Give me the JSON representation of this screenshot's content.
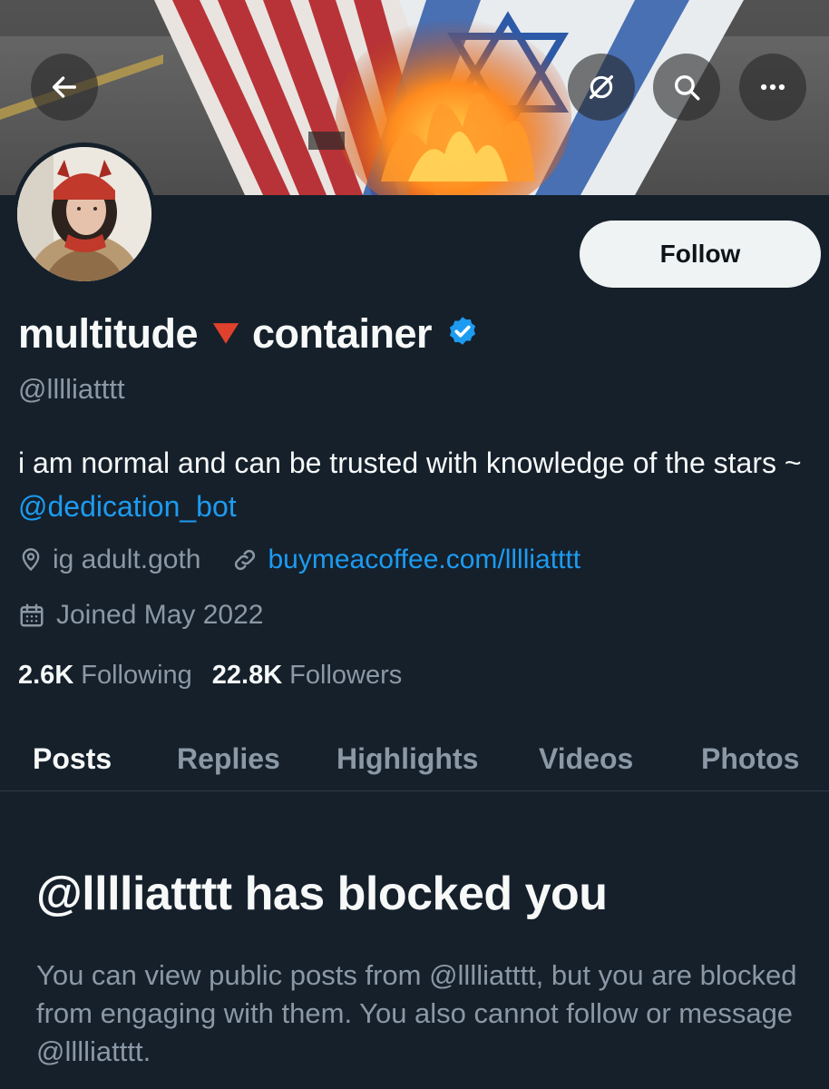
{
  "header": {
    "back_icon": "arrow-left-icon",
    "grok_icon": "grok-icon",
    "search_icon": "search-icon",
    "more_icon": "more-horizontal-icon"
  },
  "profile": {
    "follow_label": "Follow",
    "display_name_part1": "multitude",
    "display_name_part2": "container",
    "handle": "@lllliatttt",
    "bio_text": "i am normal and can be trusted with knowledge of the stars ~ ",
    "bio_mention": "@dedication_bot",
    "location": "ig adult.goth",
    "website": "buymeacoffee.com/lllliatttt",
    "joined": "Joined May 2022",
    "following_count": "2.6K",
    "following_label": "Following",
    "followers_count": "22.8K",
    "followers_label": "Followers"
  },
  "tabs": [
    {
      "label": "Posts",
      "active": true
    },
    {
      "label": "Replies",
      "active": false
    },
    {
      "label": "Highlights",
      "active": false
    },
    {
      "label": "Videos",
      "active": false
    },
    {
      "label": "Photos",
      "active": false
    }
  ],
  "blocked": {
    "title": "@lllliatttt has blocked you",
    "body": "You can view public posts from @lllliatttt, but you are blocked from engaging with them. You also cannot follow or message @lllliatttt."
  },
  "colors": {
    "background": "#15202b",
    "accent": "#1d9bf0",
    "muted": "#8b98a5"
  }
}
